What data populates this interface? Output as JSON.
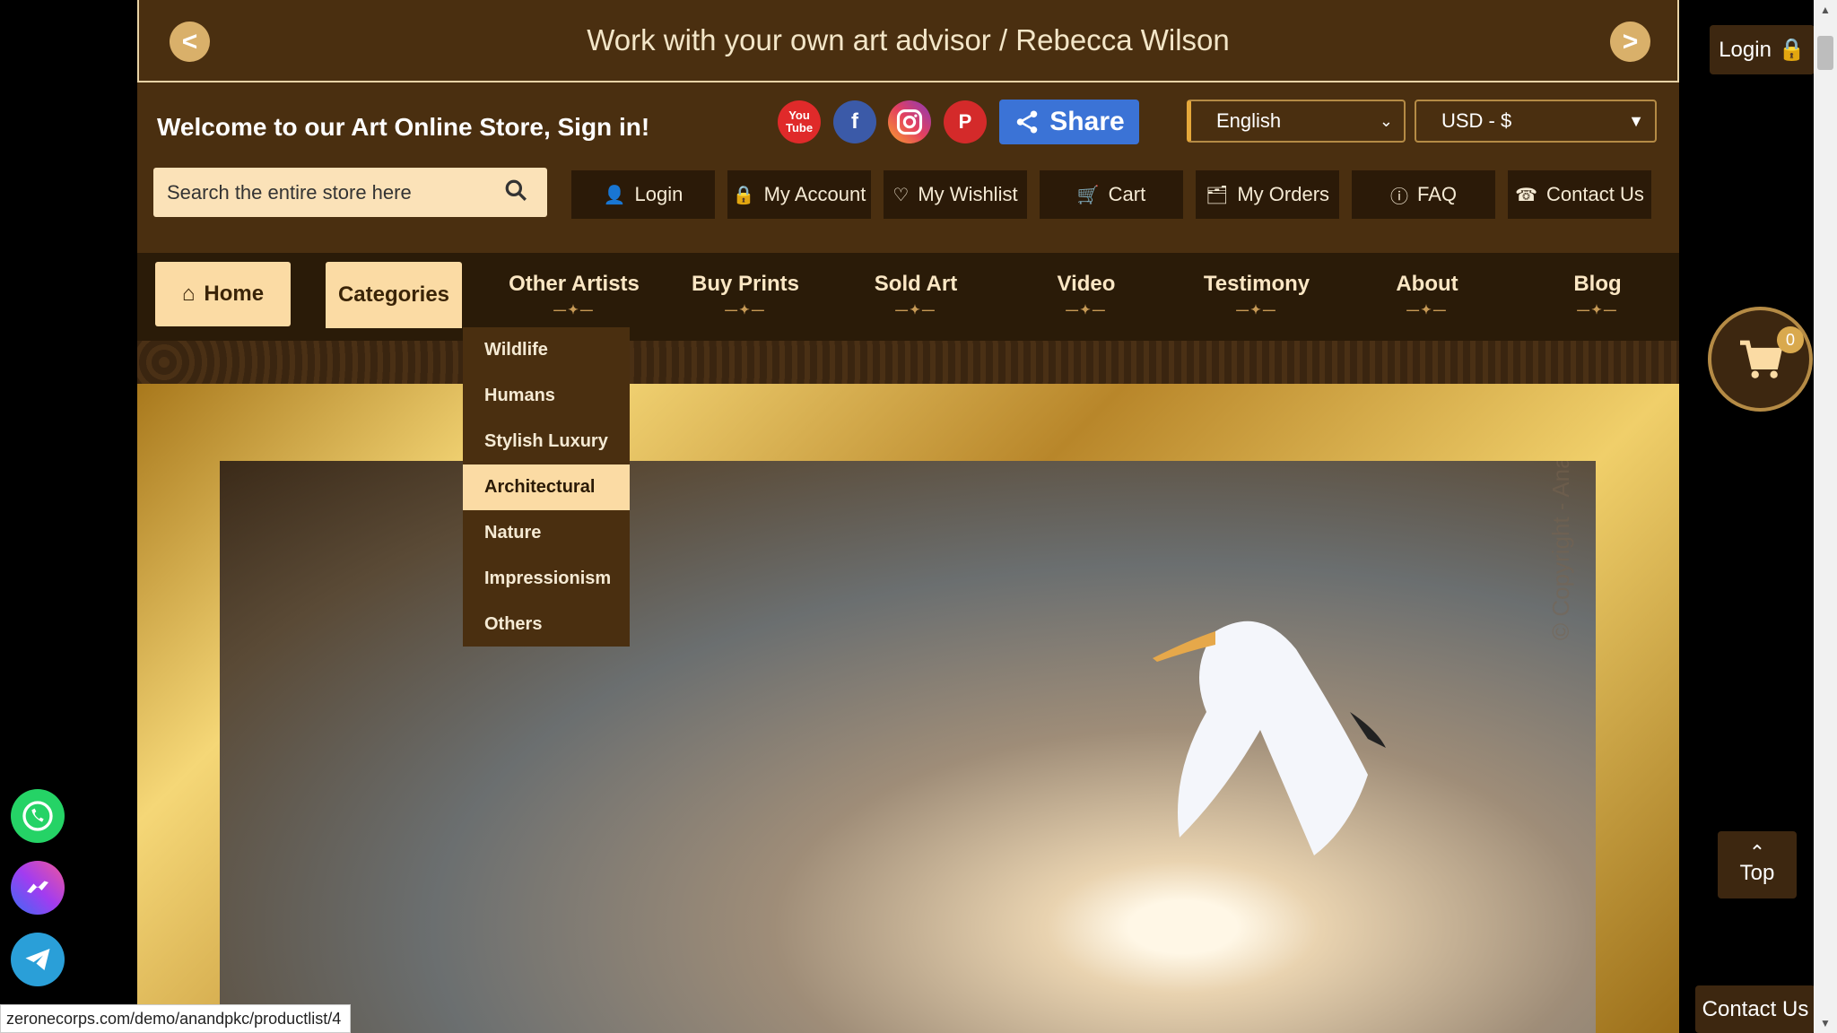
{
  "banner": {
    "text": "Work with your own art advisor / Rebecca Wilson",
    "prev": "<",
    "next": ">"
  },
  "header": {
    "welcome": "Welcome to our Art Online Store, Sign in!",
    "share_label": "Share",
    "youtube_label": "You Tube",
    "language": "English",
    "currency": "USD - $",
    "search_placeholder": "Search the entire store here"
  },
  "account_nav": [
    {
      "label": "Login",
      "icon": "user-icon"
    },
    {
      "label": "My Account",
      "icon": "lock-icon"
    },
    {
      "label": "My Wishlist",
      "icon": "heart-icon"
    },
    {
      "label": "Cart",
      "icon": "cart-icon"
    },
    {
      "label": "My Orders",
      "icon": "orders-icon"
    },
    {
      "label": "FAQ",
      "icon": "info-icon"
    },
    {
      "label": "Contact Us",
      "icon": "phone-icon"
    }
  ],
  "main_nav": {
    "home": "Home",
    "categories": "Categories",
    "items": [
      "Other Artists",
      "Buy Prints",
      "Sold Art",
      "Video",
      "Testimony",
      "About",
      "Blog"
    ]
  },
  "categories_menu": {
    "items": [
      "Wildlife",
      "Humans",
      "Stylish Luxury",
      "Architectural",
      "Nature",
      "Impressionism",
      "Others"
    ],
    "active": "Architectural"
  },
  "hero": {
    "watermark": "© Copyright - Anand PKC"
  },
  "floating": {
    "login": "Login",
    "cart_count": "0",
    "top": "Top",
    "contact": "Contact Us"
  },
  "status_url": "zeronecorps.com/demo/anandpkc/productlist/4",
  "colors": {
    "brand_brown": "#3d2710",
    "accent_cream": "#fbdba4",
    "gold": "#d9b06a"
  }
}
